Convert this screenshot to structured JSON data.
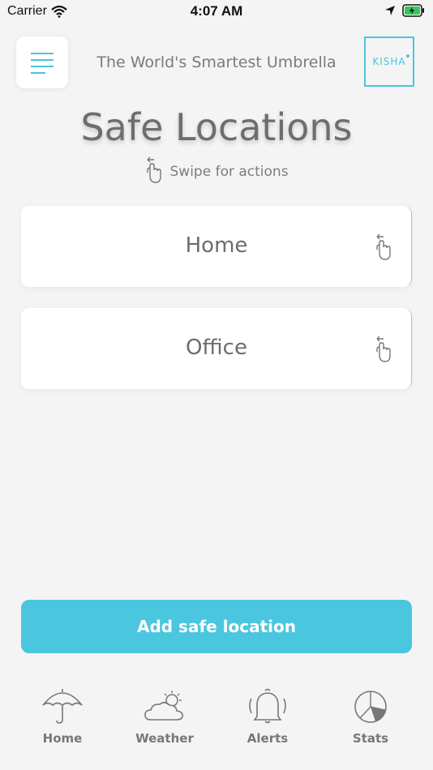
{
  "status_bar": {
    "carrier": "Carrier",
    "time": "4:07 AM"
  },
  "header": {
    "tagline": "The World's Smartest Umbrella",
    "logo_text": "KISHA"
  },
  "page": {
    "title": "Safe Locations",
    "swipe_hint": "Swipe for actions"
  },
  "locations": [
    {
      "name": "Home"
    },
    {
      "name": "Office"
    }
  ],
  "add_button": {
    "label": "Add safe location"
  },
  "tabs": [
    {
      "label": "Home",
      "icon": "umbrella-icon"
    },
    {
      "label": "Weather",
      "icon": "weather-icon"
    },
    {
      "label": "Alerts",
      "icon": "bell-icon"
    },
    {
      "label": "Stats",
      "icon": "pie-chart-icon"
    }
  ],
  "colors": {
    "accent": "#4bc6df",
    "background": "#f4f4f4",
    "text": "#6e6e6e"
  }
}
